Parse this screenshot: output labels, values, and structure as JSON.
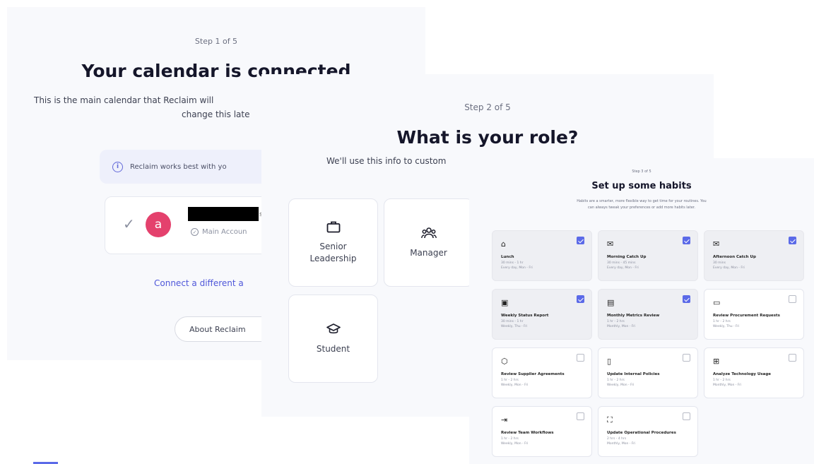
{
  "panel1": {
    "step": "Step 1 of 5",
    "title": "Your calendar is connected",
    "subtitle_line1": "This is the main calendar that Reclaim will",
    "subtitle_line2": "change this late",
    "info_text": "Reclaim works best with yo",
    "account_avatar_letter": "a",
    "account_sub": "Main Accoun",
    "connect_link": "Connect a different a",
    "about_button": "About Reclaim"
  },
  "panel2": {
    "step": "Step 2 of 5",
    "title": "What is your role?",
    "subtitle": "We'll use this info to custom",
    "roles": [
      {
        "label": "Senior Leadership",
        "icon": "briefcase-icon"
      },
      {
        "label": "Manager",
        "icon": "team-icon"
      },
      {
        "label": "Student",
        "icon": "graduation-cap-icon"
      }
    ]
  },
  "panel3": {
    "step": "Step 3 of 5",
    "title": "Set up some habits",
    "desc_line1": "Habits are a smarter, more flexible way to get time for your routines. You",
    "desc_line2": "can always tweak your preferences or add more habits later.",
    "habits": [
      {
        "name": "Lunch",
        "d1": "30 mins - 1 hr",
        "d2": "Every day, Mon - Fri",
        "checked": true,
        "icon": "lunch-icon"
      },
      {
        "name": "Morning Catch Up",
        "d1": "30 mins - 45 mins",
        "d2": "Every day, Mon - Fri",
        "checked": true,
        "icon": "mail-icon"
      },
      {
        "name": "Afternoon Catch Up",
        "d1": "30 mins",
        "d2": "Every day, Mon - Fri",
        "checked": true,
        "icon": "mail-open-icon"
      },
      {
        "name": "Weekly Status Report",
        "d1": "30 mins - 1 hr",
        "d2": "Weekly, Thu - Fri",
        "checked": true,
        "icon": "calendar-icon"
      },
      {
        "name": "Monthly Metrics Review",
        "d1": "1 hr - 2 hrs",
        "d2": "Monthly, Mon - Fri",
        "checked": true,
        "icon": "chart-icon"
      },
      {
        "name": "Review Procurement Requests",
        "d1": "1 hr - 2 hrs",
        "d2": "Weekly, Thu - Fri",
        "checked": false,
        "icon": "chat-icon"
      },
      {
        "name": "Review Supplier Agreements",
        "d1": "1 hr - 2 hrs",
        "d2": "Weekly, Mon - Fri",
        "checked": false,
        "icon": "cube-icon"
      },
      {
        "name": "Update Internal Policies",
        "d1": "1 hr - 2 hrs",
        "d2": "Weekly, Mon - Fri",
        "checked": false,
        "icon": "document-icon"
      },
      {
        "name": "Analyze Technology Usage",
        "d1": "1 hr - 2 hrs",
        "d2": "Monthly, Mon - Fri",
        "checked": false,
        "icon": "chip-icon"
      },
      {
        "name": "Review Team Workflows",
        "d1": "1 hr - 2 hrs",
        "d2": "Weekly, Mon - Fri",
        "checked": false,
        "icon": "login-icon"
      },
      {
        "name": "Update Operational Procedures",
        "d1": "2 hrs - 4 hrs",
        "d2": "Monthly, Mon - Fri",
        "checked": false,
        "icon": "workflow-icon"
      }
    ]
  },
  "colors": {
    "accent": "#5b6ae8",
    "avatar": "#e4416d",
    "link": "#4f57d9"
  }
}
